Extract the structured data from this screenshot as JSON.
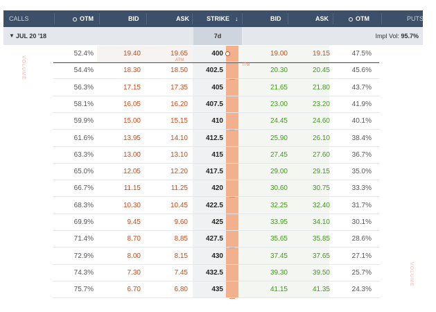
{
  "header": {
    "calls": "CALLS",
    "otm_left": "OTM",
    "bid_left": "BID",
    "ask_left": "ASK",
    "strike": "STRIKE",
    "sort_icon": "down-arrow",
    "bid_right": "BID",
    "ask_right": "ASK",
    "otm_right": "OTM",
    "puts": "PUTS"
  },
  "expiry": {
    "label": "JUL 20 '18",
    "days": "7d",
    "impl_vol_label": "Impl Vol:",
    "impl_vol_value": "95.7%"
  },
  "annotations": {
    "atm_calls": "ATM",
    "itm_puts": "ITM",
    "volume_left": "VOLUME",
    "volume_right": "VOLUME"
  },
  "rows": [
    {
      "call_otm": "52.4%",
      "call_bid": "19.40",
      "call_ask": "19.65",
      "strike": "400",
      "put_bid": "19.00",
      "put_ask": "19.15",
      "put_otm": "47.5%"
    },
    {
      "call_otm": "54.4%",
      "call_bid": "18.30",
      "call_ask": "18.50",
      "strike": "402.5",
      "put_bid": "20.30",
      "put_ask": "20.45",
      "put_otm": "45.6%"
    },
    {
      "call_otm": "56.3%",
      "call_bid": "17.15",
      "call_ask": "17.35",
      "strike": "405",
      "put_bid": "21.65",
      "put_ask": "21.80",
      "put_otm": "43.7%"
    },
    {
      "call_otm": "58.1%",
      "call_bid": "16.05",
      "call_ask": "16.20",
      "strike": "407.5",
      "put_bid": "23.00",
      "put_ask": "23.20",
      "put_otm": "41.9%"
    },
    {
      "call_otm": "59.9%",
      "call_bid": "15.00",
      "call_ask": "15.15",
      "strike": "410",
      "put_bid": "24.45",
      "put_ask": "24.60",
      "put_otm": "40.1%"
    },
    {
      "call_otm": "61.6%",
      "call_bid": "13.95",
      "call_ask": "14.10",
      "strike": "412.5",
      "put_bid": "25.90",
      "put_ask": "26.10",
      "put_otm": "38.4%"
    },
    {
      "call_otm": "63.3%",
      "call_bid": "13.00",
      "call_ask": "13.10",
      "strike": "415",
      "put_bid": "27.45",
      "put_ask": "27.60",
      "put_otm": "36.7%"
    },
    {
      "call_otm": "65.0%",
      "call_bid": "12.05",
      "call_ask": "12.20",
      "strike": "417.5",
      "put_bid": "29.00",
      "put_ask": "29.15",
      "put_otm": "35.0%"
    },
    {
      "call_otm": "66.7%",
      "call_bid": "11.15",
      "call_ask": "11.25",
      "strike": "420",
      "put_bid": "30.60",
      "put_ask": "30.75",
      "put_otm": "33.3%"
    },
    {
      "call_otm": "68.3%",
      "call_bid": "10.30",
      "call_ask": "10.45",
      "strike": "422.5",
      "put_bid": "32.25",
      "put_ask": "32.40",
      "put_otm": "31.7%"
    },
    {
      "call_otm": "69.9%",
      "call_bid": "9.45",
      "call_ask": "9.60",
      "strike": "425",
      "put_bid": "33.95",
      "put_ask": "34.10",
      "put_otm": "30.1%"
    },
    {
      "call_otm": "71.4%",
      "call_bid": "8.70",
      "call_ask": "8.85",
      "strike": "427.5",
      "put_bid": "35.65",
      "put_ask": "35.85",
      "put_otm": "28.6%"
    },
    {
      "call_otm": "72.9%",
      "call_bid": "8.00",
      "call_ask": "8.15",
      "strike": "430",
      "put_bid": "37.45",
      "put_ask": "37.65",
      "put_otm": "27.1%"
    },
    {
      "call_otm": "74.3%",
      "call_bid": "7.30",
      "call_ask": "7.45",
      "strike": "432.5",
      "put_bid": "39.30",
      "put_ask": "39.50",
      "put_otm": "25.7%"
    },
    {
      "call_otm": "75.7%",
      "call_bid": "6.70",
      "call_ask": "6.80",
      "strike": "435",
      "put_bid": "41.15",
      "put_ask": "41.35",
      "put_otm": "24.3%"
    }
  ],
  "colors": {
    "header_bg": "#3d5069",
    "call_price": "#c14d1d",
    "put_price": "#3f9a19",
    "strike_marker": "#f2b08d"
  }
}
